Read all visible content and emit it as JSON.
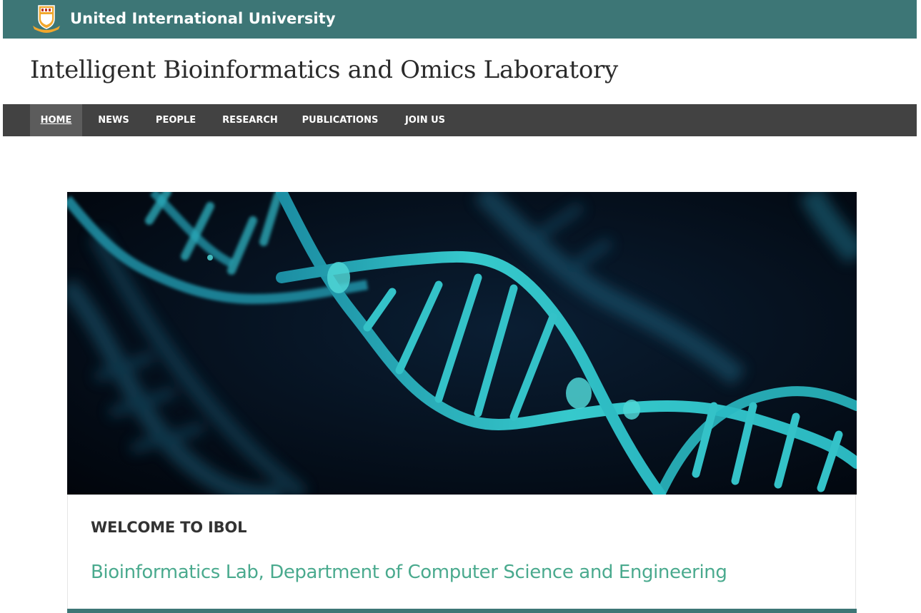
{
  "header": {
    "university_name": "United International University",
    "logo_icon": "university-crest-icon"
  },
  "site": {
    "title": "Intelligent Bioinformatics and Omics Laboratory"
  },
  "nav": {
    "items": [
      {
        "label": "HOME",
        "active": true
      },
      {
        "label": "NEWS",
        "active": false
      },
      {
        "label": "PEOPLE",
        "active": false
      },
      {
        "label": "RESEARCH",
        "active": false
      },
      {
        "label": "PUBLICATIONS",
        "active": false
      },
      {
        "label": "JOIN US",
        "active": false
      }
    ]
  },
  "hero": {
    "image_icon": "dna-helix-banner"
  },
  "content": {
    "welcome_heading": "WELCOME TO IBOL",
    "subtitle": "Bioinformatics Lab, Department of Computer Science and Engineering"
  },
  "colors": {
    "brand_teal": "#3d7676",
    "nav_bg": "#424242",
    "nav_active_bg": "#5c5c5c",
    "subtitle_green": "#4aaa8e",
    "dna_cyan": "#2ec4c8"
  }
}
